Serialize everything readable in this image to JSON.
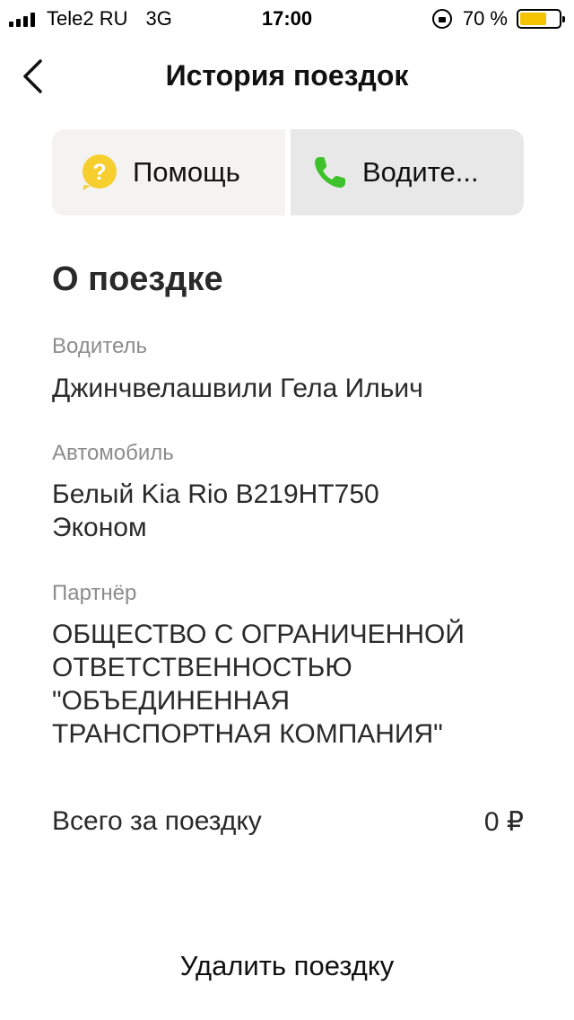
{
  "status_bar": {
    "carrier": "Tele2 RU",
    "network": "3G",
    "time": "17:00",
    "battery_percent": "70 %",
    "battery_level": 0.7,
    "battery_color": "#f5c400"
  },
  "nav": {
    "title": "История поездок",
    "back_icon": "chevron-left-icon"
  },
  "actions": {
    "help": {
      "label": "Помощь",
      "icon": "help-bubble-icon",
      "icon_color": "#f6cf2e"
    },
    "driver": {
      "label": "Водите...",
      "icon": "phone-icon",
      "icon_color": "#3ec22b"
    }
  },
  "trip": {
    "section_title": "О поездке",
    "driver_label": "Водитель",
    "driver_value": "Джинчвелашвили Гела Ильич",
    "car_label": "Автомобиль",
    "car_value_line1": "Белый Kia Rio В219НТ750",
    "car_value_line2": "Эконом",
    "partner_label": "Партнёр",
    "partner_line1": "ОБЩЕСТВО С ОГРАНИЧЕННОЙ",
    "partner_line2": "ОТВЕТСТВЕННОСТЬЮ",
    "partner_line3": "\"ОБЪЕДИНЕННАЯ",
    "partner_line4": "ТРАНСПОРТНАЯ КОМПАНИЯ\"",
    "total_label": "Всего за поездку",
    "total_value": "0 ₽"
  },
  "footer": {
    "delete_label": "Удалить поездку"
  }
}
